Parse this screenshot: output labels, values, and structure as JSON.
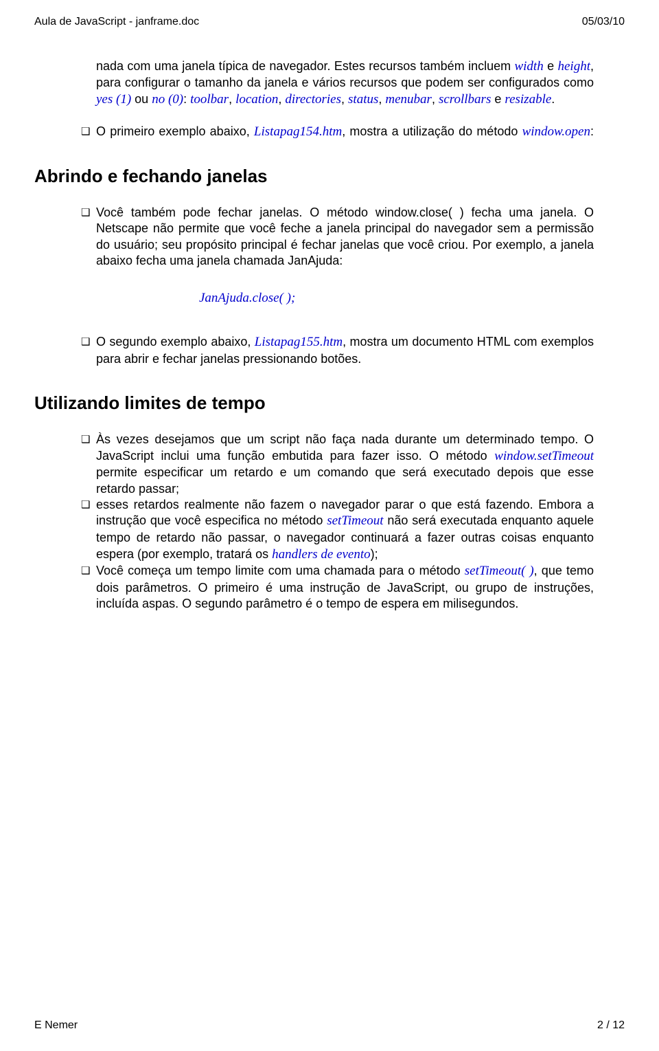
{
  "header": {
    "left": "Aula de JavaScript - janframe.doc",
    "right": "05/03/10"
  },
  "bullets1": [
    {
      "pre": "nada com uma janela típica de navegador. Estes recursos também incluem ",
      "i1": "width",
      "txt2": " e ",
      "i2": "height",
      "txt3": ", para configurar o tamanho da janela e vários recursos que podem ser configurados como ",
      "i3": "yes (1)",
      "txt4": " ou ",
      "i4": "no (0)",
      "txt5": ": ",
      "i5": "toolbar",
      "c1": ", ",
      "i6": "location",
      "c2": ", ",
      "i7": "directories",
      "c3": ", ",
      "i8": "status",
      "c4": ", ",
      "i9": "menubar",
      "c5": ", ",
      "i10": "scrollbars",
      "txt6": " e ",
      "i11": "resizable",
      "end": "."
    },
    {
      "pre": "O primeiro exemplo abaixo, ",
      "i1": "Listapag154.htm",
      "txt2": ",    mostra a utilização do método ",
      "i2": "window.open",
      "end": ":"
    }
  ],
  "section1": "Abrindo e fechando janelas",
  "bullets2": [
    {
      "pre": "Você também pode fechar janelas. O método window.close( ) fecha uma janela. O Netscape não permite que você feche a janela principal do navegador sem a permissão do usuário; seu propósito principal é fechar janelas que você criou. Por exemplo, a janela abaixo fecha uma janela chamada JanAjuda:"
    }
  ],
  "code": "JanAjuda.close( );",
  "bullets3": [
    {
      "pre": "O segundo exemplo abaixo, ",
      "i1": "Listapag155.htm",
      "txt2": ", mostra um documento HTML com exemplos para abrir e fechar janelas pressionando botões."
    }
  ],
  "section2": "Utilizando limites de tempo",
  "bullets4": [
    {
      "pre": "Às vezes desejamos que um script não faça nada durante um determinado tempo. O JavaScript inclui uma função embutida para fazer isso. O método ",
      "i1": "window.setTimeout",
      "txt2": " permite especificar um retardo e um comando que será executado depois que esse retardo passar;"
    },
    {
      "pre": "esses retardos realmente não fazem o navegador parar o que está fazendo. Embora a instrução que você especifica no método ",
      "i1": "setTimeout",
      "txt2": " não será executada enquanto aquele tempo de retardo não passar, o navegador continuará a fazer outras coisas enquanto espera (por exemplo, tratará os ",
      "i2": "handlers de evento",
      "txt3": ");"
    },
    {
      "pre": "Você começa um tempo limite com uma chamada para o método ",
      "i1": "setTimeout( )",
      "txt2": ", que temo dois parâmetros. O primeiro é uma instrução de JavaScript, ou grupo de instruções, incluída aspas. O segundo parâmetro é o tempo de espera em milisegundos."
    }
  ],
  "footer": {
    "left": "E Nemer",
    "right": "2 / 12"
  }
}
